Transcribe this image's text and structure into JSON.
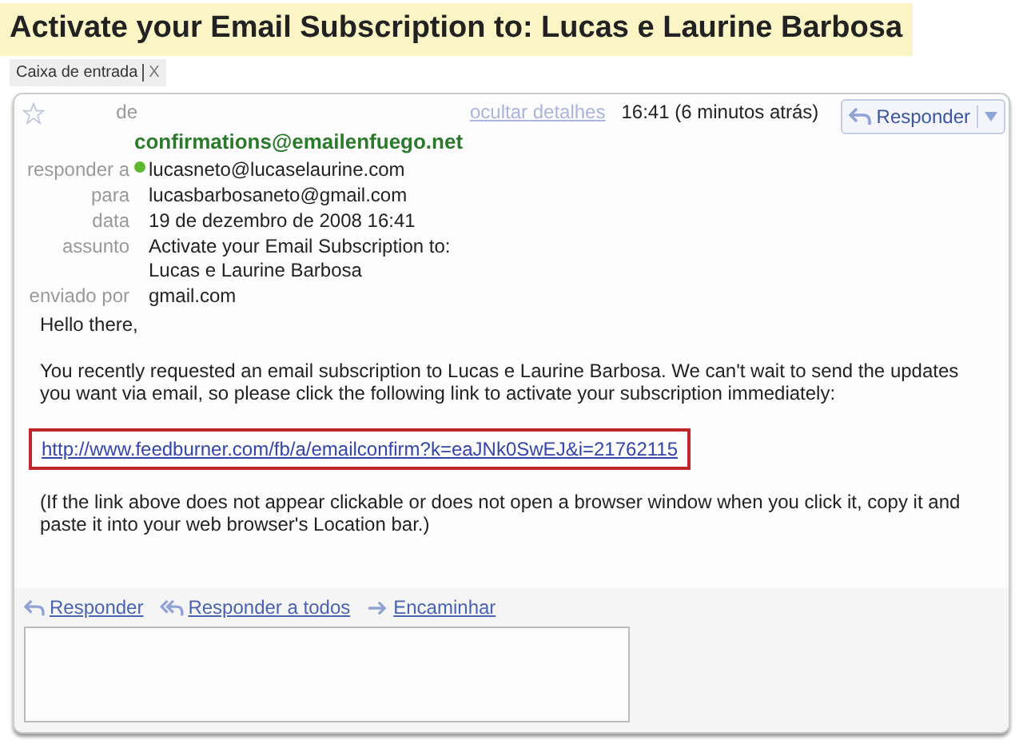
{
  "subject_title": "Activate your Email Subscription to: Lucas e Laurine Barbosa",
  "labels": [
    {
      "text": "Caixa de entrada",
      "remove": "X"
    }
  ],
  "message": {
    "starred": false,
    "from_label": "de",
    "from": "confirmations@emailenfuego.net",
    "hide_details": "ocultar detalhes",
    "time": "16:41 (6 minutos atrás)",
    "reply_button": "Responder",
    "details": [
      {
        "label": "responder a",
        "value": "lucasneto@lucaselaurine.com",
        "online": true
      },
      {
        "label": "para",
        "value": "lucasbarbosaneto@gmail.com",
        "online": false
      },
      {
        "label": "data",
        "value": "19 de dezembro de 2008 16:41",
        "online": false
      },
      {
        "label": "assunto",
        "value": "Activate your Email Subscription to: Lucas e Laurine Barbosa",
        "online": false
      },
      {
        "label": "enviado por",
        "value": "gmail.com",
        "online": false
      }
    ],
    "body": [
      {
        "kind": "text",
        "text": "Hello there,"
      },
      {
        "kind": "text",
        "text": "You recently requested an email subscription to Lucas e Laurine Barbosa. We can't wait to send the updates you want via email, so please click the following link to activate your subscription immediately:"
      },
      {
        "kind": "link",
        "text": "http://www.feedburner.com/fb/a/emailconfirm?k=eaJNk0SwEJ&i=21762115",
        "highlighted": true
      },
      {
        "kind": "text",
        "text": "(If the link above does not appear clickable or does not open a browser window when you click it, copy it and paste it into your web browser's Location bar.)"
      }
    ],
    "actions": [
      {
        "kind": "reply",
        "label": "Responder"
      },
      {
        "kind": "reply_all",
        "label": "Responder a todos"
      },
      {
        "kind": "forward",
        "label": "Encaminhar"
      }
    ]
  }
}
